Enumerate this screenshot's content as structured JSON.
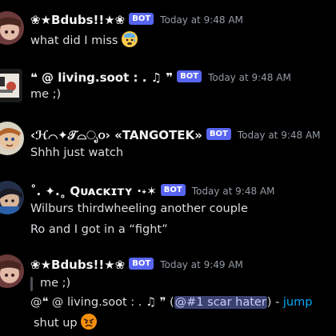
{
  "messages": [
    {
      "username": "❀★Bdubs!!★❀",
      "badge": "BOT",
      "timestamp": "Today at 9:48 AM",
      "text": "what did I miss",
      "emoji": "anxious-sweat-emoji"
    },
    {
      "username": "❝ @ living.soot : . ♫ ❞",
      "badge": "BOT",
      "timestamp": "Today at 9:48 AM",
      "text": "me ;)"
    },
    {
      "username": "‹ℋ⌒✦𝒯⌓ೃ૦› «TANGOTEK»",
      "badge": "BOT",
      "timestamp": "Today at 9:48 AM",
      "text": "Shhh just watch"
    },
    {
      "username": "˚. ✦.˳ Qᴜᴀᴄᴋɪᴛʏ ·˖✶",
      "badge": "BOT",
      "timestamp": "Today at 9:48 AM",
      "lines": [
        "Wilburs thirdwheeling another couple",
        "Ro and I got in a “fight”"
      ]
    },
    {
      "username": "❀★Bdubs!!★❀",
      "badge": "BOT",
      "timestamp": "Today at 9:49 AM",
      "quote": "me ;)",
      "reply_prefix": "@❝ @ living.soot : . ♫ ❞ (",
      "mention": "@#1 scar hater",
      "reply_suffix": ") - ",
      "jump": "jump",
      "text": "shut up",
      "emoji": "angry-emoji"
    }
  ],
  "colors": {
    "background": "#000000",
    "bot_badge": "#5865f2",
    "timestamp": "#949ba4",
    "link": "#00a8fc"
  }
}
